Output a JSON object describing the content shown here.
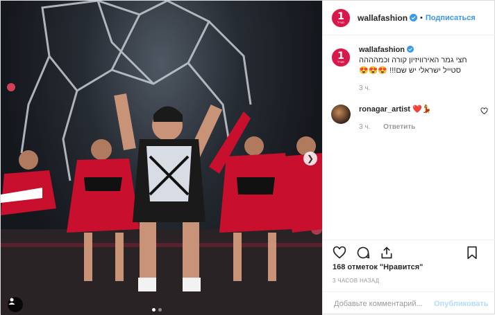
{
  "header": {
    "username": "wallafashion",
    "separator": "•",
    "follow_label": "Подписаться",
    "avatar_text": "1",
    "avatar_sub": "סטייל"
  },
  "caption": {
    "username": "wallafashion",
    "text": "חצי גמר האירוויזיון קורה וכמהההה סטייל ישראלי יש שם!!! 😍😍😍",
    "time": "3 ч."
  },
  "comment": {
    "username": "ronagar_artist",
    "text": "❤️💃",
    "time": "3 ч.",
    "reply_label": "Ответить"
  },
  "likes_text": "168 отметок \"Нравится\"",
  "timestamp": "3 ЧАСОВ НАЗАД",
  "add_comment": {
    "placeholder": "Добавьте комментарий...",
    "publish_label": "Опубликовать"
  },
  "carousel": {
    "total": 2,
    "current": 1
  },
  "colors": {
    "accent": "#3897f0",
    "brand": "#d8184a"
  }
}
